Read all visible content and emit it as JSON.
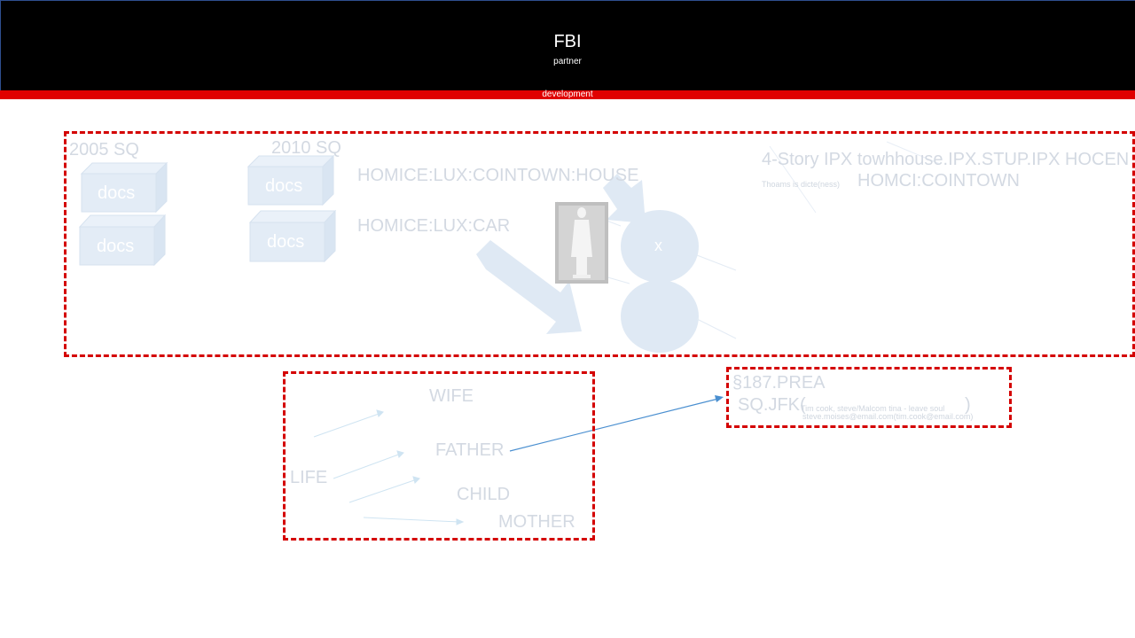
{
  "header": {
    "title": "FBI",
    "subtitle": "partner"
  },
  "banner": {
    "label": "development"
  },
  "top_group": {
    "year_a": "2005 SQ",
    "year_b": "2010 SQ",
    "docs": [
      "docs",
      "docs",
      "docs",
      "docs"
    ],
    "label_house": "HOMICE:LUX:COINTOWN:HOUSE",
    "label_car": "HOMICE:LUX:CAR",
    "circle_label": "x",
    "townhouse": "4-Story IPX towhhouse.IPX.STUP.IPX HOCEN",
    "small_note": "Thoams is dicte(ness)",
    "homci": "HOMCI:COINTOWN"
  },
  "family_group": {
    "wife": "WIFE",
    "father": "FATHER",
    "life": "LIFE",
    "child": "CHILD",
    "mother": "MOTHER"
  },
  "law_group": {
    "code": "§187.PREA",
    "prefix": "SQ.JFK(",
    "names": "Tim cook, steve/Malcom tina - leave soul",
    "emails": "steve.moises@email.com(tim.cook@email.com)",
    "suffix": ")"
  },
  "colors": {
    "header_bg": "#000000",
    "banner": "#e00000",
    "dash": "#d40000",
    "arrow": "#4a8fd0",
    "faint": "#dde7f2"
  }
}
